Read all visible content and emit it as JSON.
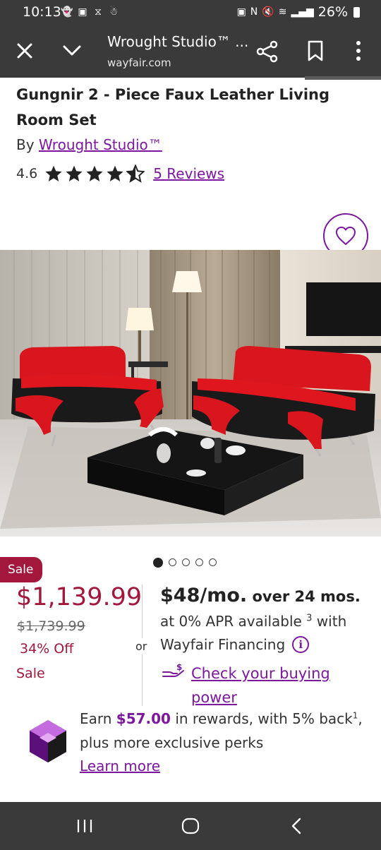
{
  "status": {
    "time": "10:13",
    "battery": "26%",
    "left_icons": [
      "snapchat-icon",
      "free-stuff-icon",
      "gallery-icon",
      "person-icon"
    ]
  },
  "toolbar": {
    "title": "Wrought Studio™ ...",
    "url": "wayfair.com"
  },
  "product": {
    "title": "Gungnir 2 - Piece Faux Leather Living Room Set",
    "by_prefix": "By ",
    "brand": "Wrought Studio™",
    "rating": "4.6",
    "rating_value": 4.6,
    "rating_max": 5,
    "reviews": "5 Reviews"
  },
  "gallery": {
    "total": 5,
    "active": 0
  },
  "pricing": {
    "badge": "Sale",
    "price": "$1,139.99",
    "original": "$1,739.99",
    "discount": "34% Off",
    "sale_label": "Sale",
    "or": "or"
  },
  "financing": {
    "monthly": "$48/mo.",
    "term": " over 24 mos.",
    "apr": "at 0% APR available ",
    "apr_sup": "3",
    "apr_suffix": " with",
    "provider": "Wayfair Financing",
    "info_icon": "i",
    "check_link": "Check your buying power"
  },
  "rewards": {
    "earn_prefix": "Earn ",
    "amount": "$57.00",
    "earn_suffix": " in rewards, with 5% back",
    "sup": "1",
    "comma": ",",
    "line2": "plus more exclusive perks",
    "learn_more": "Learn more"
  },
  "colors": {
    "brand_purple": "#7b189f",
    "sale_red": "#a3173d",
    "chrome": "#3a3a3a"
  }
}
